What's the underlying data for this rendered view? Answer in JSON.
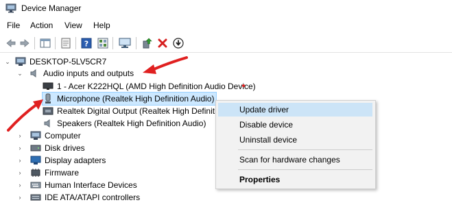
{
  "window": {
    "title": "Device Manager"
  },
  "menu": [
    "File",
    "Action",
    "View",
    "Help"
  ],
  "toolbar": {
    "buttons": [
      "back-icon",
      "forward-icon",
      "show-hide-tree-icon",
      "properties-icon",
      "help-icon",
      "driver-details-icon",
      "monitor-icon",
      "update-driver-icon",
      "uninstall-icon",
      "download-icon"
    ]
  },
  "tree": {
    "root": "DESKTOP-5LV5CR7",
    "audio_category": "Audio inputs and outputs",
    "audio_items": [
      "1 - Acer K222HQL (AMD High Definition Audio Device)",
      "Microphone (Realtek High Definition Audio)",
      "Realtek Digital Output (Realtek High Definiti",
      "Speakers (Realtek High Definition Audio)"
    ],
    "categories": [
      "Computer",
      "Disk drives",
      "Display adapters",
      "Firmware",
      "Human Interface Devices",
      "IDE ATA/ATAPI controllers"
    ]
  },
  "context_menu": {
    "items": [
      "Update driver",
      "Disable device",
      "Uninstall device",
      "Scan for hardware changes",
      "Properties"
    ]
  },
  "colors": {
    "selection": "#cce8ff",
    "menu_highlight": "#cce4f7",
    "annotation_arrow": "#e02020",
    "uninstall_red": "#d62020"
  }
}
